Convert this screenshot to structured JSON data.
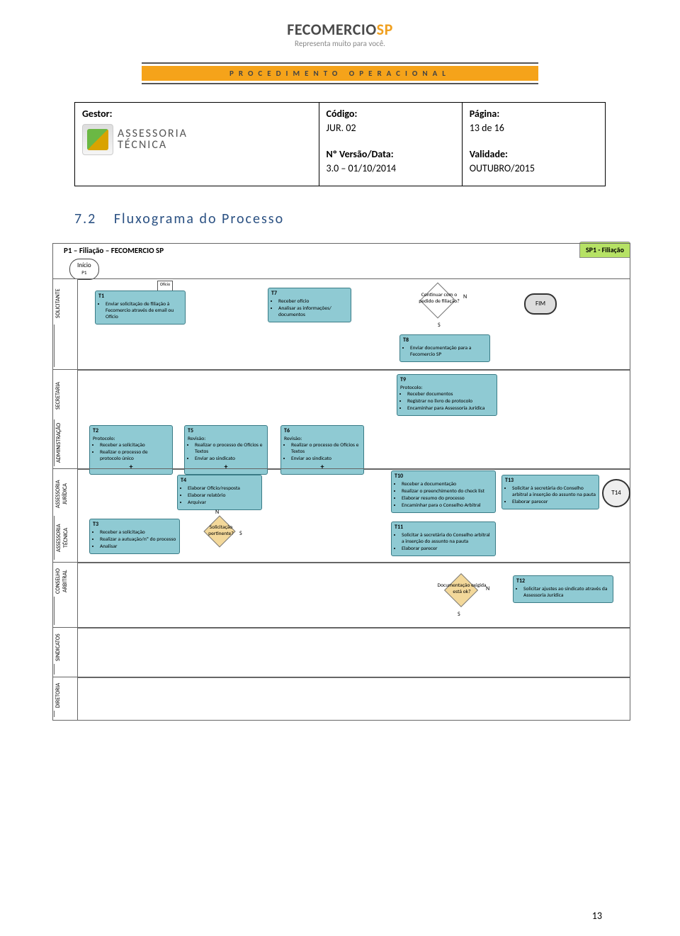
{
  "brand": {
    "name": "FECOMERCIO",
    "suffix": "SP",
    "tagline": "Representa muito para você."
  },
  "banner": "PROCEDIMENTO  OPERACIONAL",
  "meta": {
    "gestor_label": "Gestor:",
    "assessoria_line1": "ASSESSORIA",
    "assessoria_line2": "TÉCNICA",
    "codigo_label": "Código:",
    "codigo_value": "JUR. 02",
    "versao_label": "Nº Versão/Data:",
    "versao_value": "3.0 – 01/10/2014",
    "pagina_label": "Página:",
    "pagina_value": "13 de 16",
    "validade_label": "Validade:",
    "validade_value": "OUTUBRO/2015"
  },
  "section": {
    "number": "7.2",
    "title": "Fluxograma do Processo"
  },
  "pool": {
    "title": "P1 – Filiação – FECOMERCIO SP",
    "tab": "SP1 - Filiação"
  },
  "start": {
    "label": "Início",
    "sub": "P1"
  },
  "doc": "Ofício",
  "lanes": {
    "solicitante": "SOLICITANTE",
    "admin_outer": "ADMINISTRAÇÃO",
    "admin_inner": "SECRETARIA",
    "assess_outer": "ASSESSORIA TÉCNICA",
    "assess_inner": "ASSESSORIA JURÍDICA",
    "consel": "CONSELHO ARBITRAL",
    "sind": "SINDICATOS",
    "dir": "DIRETORIA"
  },
  "tasks": {
    "t1": {
      "id": "T1",
      "items": [
        "Enviar solicitação de filiação à Fecomercio através de email ou Ofício"
      ]
    },
    "t7": {
      "id": "T7",
      "items": [
        "Receber ofício",
        "Analisar as informações/ documentos"
      ]
    },
    "t8": {
      "id": "T8",
      "items": [
        "Enviar documentação para a Fecomercio SP"
      ]
    },
    "t9": {
      "id": "T9",
      "head": "Protocolo:",
      "items": [
        "Receber documentos",
        "Registrar no livro de protocolo",
        "Encaminhar para Assessoria Jurídica"
      ]
    },
    "t2": {
      "id": "T2",
      "head": "Protocolo:",
      "items": [
        "Receber a solicitação",
        "Realizar o processo de protocolo único"
      ]
    },
    "t5": {
      "id": "T5",
      "head": "Revisão:",
      "items": [
        "Realizar o processo de Ofícios e Textos",
        "Enviar ao sindicato"
      ]
    },
    "t6": {
      "id": "T6",
      "head": "Revisão:",
      "items": [
        "Realizar o processo de Ofícios e Textos",
        "Enviar ao sindicato"
      ]
    },
    "t4": {
      "id": "T4",
      "items": [
        "Elaborar Ofício/resposta",
        "Elaborar relatório",
        "Arquivar"
      ]
    },
    "t3": {
      "id": "T3",
      "items": [
        "Receber a solicitação",
        "Realizar a autuação/nº do processo",
        "Analisar"
      ]
    },
    "t10": {
      "id": "T10",
      "items": [
        "Receber a documentação",
        "Realizar o preenchimento do check list",
        "Elaborar resumo do processo",
        "Encaminhar para o Conselho Arbitral"
      ]
    },
    "t11": {
      "id": "T11",
      "items": [
        "Solicitar à secretária do Conselho arbitral a inserção do assunto na pauta",
        "Elaborar parecer"
      ]
    },
    "t13": {
      "id": "T13",
      "items": [
        "Solicitar à secretária do Conselho arbitral a inserção do assunto na pauta",
        "Elaborar parecer"
      ]
    },
    "t12": {
      "id": "T12",
      "items": [
        "Solicitar ajustes ao sindicato através da Assessoria Jurídica"
      ]
    }
  },
  "gateways": {
    "g1": {
      "text": "Continuar com o pedido de filiação?",
      "yes": "S",
      "no": "N"
    },
    "g2": {
      "text": "Solicitação pertinente?",
      "yes": "S",
      "no": "N"
    },
    "g3": {
      "text": "Documentação exigida está ok?",
      "yes": "S",
      "no": "N"
    }
  },
  "end": {
    "fim": "FIM",
    "ref": "T14"
  },
  "footer_page": "13"
}
